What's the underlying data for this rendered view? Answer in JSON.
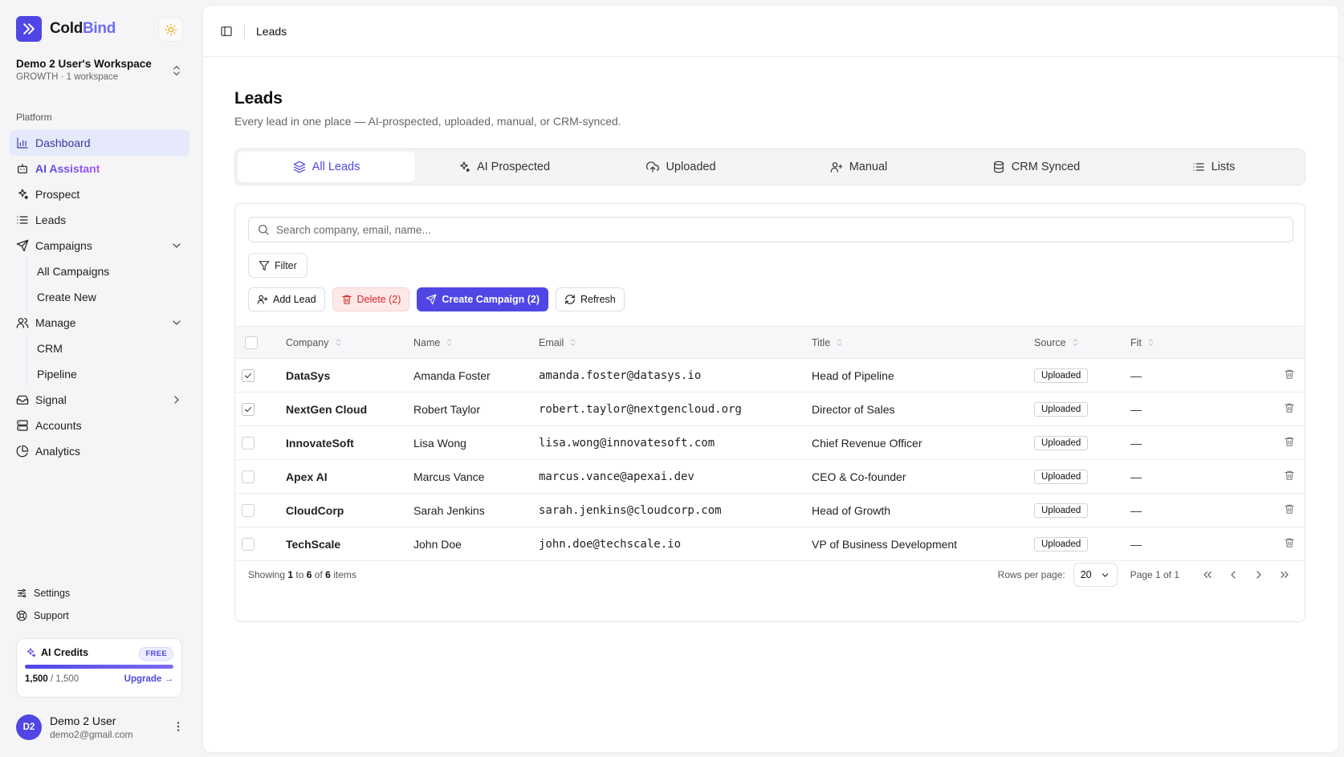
{
  "brand": {
    "name_a": "Cold",
    "name_b": "Bind"
  },
  "workspace": {
    "name": "Demo 2 User's Workspace",
    "sub": "GROWTH · 1 workspace"
  },
  "sidebar": {
    "section_label": "Platform",
    "items": [
      {
        "label": "Dashboard",
        "icon": "bar-chart-icon"
      },
      {
        "label": "AI Assistant",
        "icon": "bot-icon"
      },
      {
        "label": "Prospect",
        "icon": "sparkles-icon"
      },
      {
        "label": "Leads",
        "icon": "list-icon"
      },
      {
        "label": "Campaigns",
        "icon": "send-icon"
      },
      {
        "label": "All Campaigns"
      },
      {
        "label": "Create New"
      },
      {
        "label": "Manage",
        "icon": "users-icon"
      },
      {
        "label": "CRM"
      },
      {
        "label": "Pipeline"
      },
      {
        "label": "Signal",
        "icon": "inbox-icon"
      },
      {
        "label": "Accounts",
        "icon": "server-icon"
      },
      {
        "label": "Analytics",
        "icon": "pie-chart-icon"
      }
    ],
    "bottom": [
      {
        "label": "Settings",
        "icon": "sliders-icon"
      },
      {
        "label": "Support",
        "icon": "life-buoy-icon"
      }
    ]
  },
  "credits": {
    "title": "AI Credits",
    "badge": "FREE",
    "used": "1,500",
    "total": "/ 1,500",
    "progress": 1.0,
    "upgrade": "Upgrade →"
  },
  "user": {
    "initials": "D2",
    "name": "Demo 2 User",
    "email": "demo2@gmail.com"
  },
  "header": {
    "breadcrumb": "Leads"
  },
  "page": {
    "title": "Leads",
    "subtitle": "Every lead in one place — AI-prospected, uploaded, manual, or CRM-synced."
  },
  "tabs": [
    {
      "label": "All Leads",
      "icon": "layers-icon",
      "active": true
    },
    {
      "label": "AI Prospected",
      "icon": "sparkles-icon"
    },
    {
      "label": "Uploaded",
      "icon": "cloud-upload-icon"
    },
    {
      "label": "Manual",
      "icon": "user-plus-icon"
    },
    {
      "label": "CRM Synced",
      "icon": "database-icon"
    },
    {
      "label": "Lists",
      "icon": "list-icon"
    }
  ],
  "search": {
    "placeholder": "Search company, email, name..."
  },
  "toolbar": {
    "filter_label": "Filter",
    "add_lead_label": "Add Lead",
    "delete_label": "Delete (2)",
    "create_campaign_label": "Create Campaign (2)",
    "refresh_label": "Refresh"
  },
  "table": {
    "columns": [
      "Company",
      "Name",
      "Email",
      "Title",
      "Source",
      "Fit"
    ],
    "rows": [
      {
        "checked": true,
        "company": "DataSys",
        "name": "Amanda Foster",
        "email": "amanda.foster@datasys.io",
        "title": "Head of Pipeline",
        "source": "Uploaded",
        "fit": "—"
      },
      {
        "checked": true,
        "company": "NextGen Cloud",
        "name": "Robert Taylor",
        "email": "robert.taylor@nextgencloud.org",
        "title": "Director of Sales",
        "source": "Uploaded",
        "fit": "—"
      },
      {
        "checked": false,
        "company": "InnovateSoft",
        "name": "Lisa Wong",
        "email": "lisa.wong@innovatesoft.com",
        "title": "Chief Revenue Officer",
        "source": "Uploaded",
        "fit": "—"
      },
      {
        "checked": false,
        "company": "Apex AI",
        "name": "Marcus Vance",
        "email": "marcus.vance@apexai.dev",
        "title": "CEO & Co-founder",
        "source": "Uploaded",
        "fit": "—"
      },
      {
        "checked": false,
        "company": "CloudCorp",
        "name": "Sarah Jenkins",
        "email": "sarah.jenkins@cloudcorp.com",
        "title": "Head of Growth",
        "source": "Uploaded",
        "fit": "—"
      },
      {
        "checked": false,
        "company": "TechScale",
        "name": "John Doe",
        "email": "john.doe@techscale.io",
        "title": "VP of Business Development",
        "source": "Uploaded",
        "fit": "—"
      }
    ]
  },
  "footer": {
    "showing_prefix": "Showing",
    "from": "1",
    "to_word": "to",
    "to": "6",
    "of_word": "of",
    "total": "6",
    "items_word": "items",
    "rows_per_page_label": "Rows per page:",
    "rows_per_page": "20",
    "page_info": "Page 1 of 1"
  },
  "colors": {
    "accent": "#4f46e5",
    "danger": "#dc2626",
    "active_nav_bg": "#e6e9fb"
  }
}
